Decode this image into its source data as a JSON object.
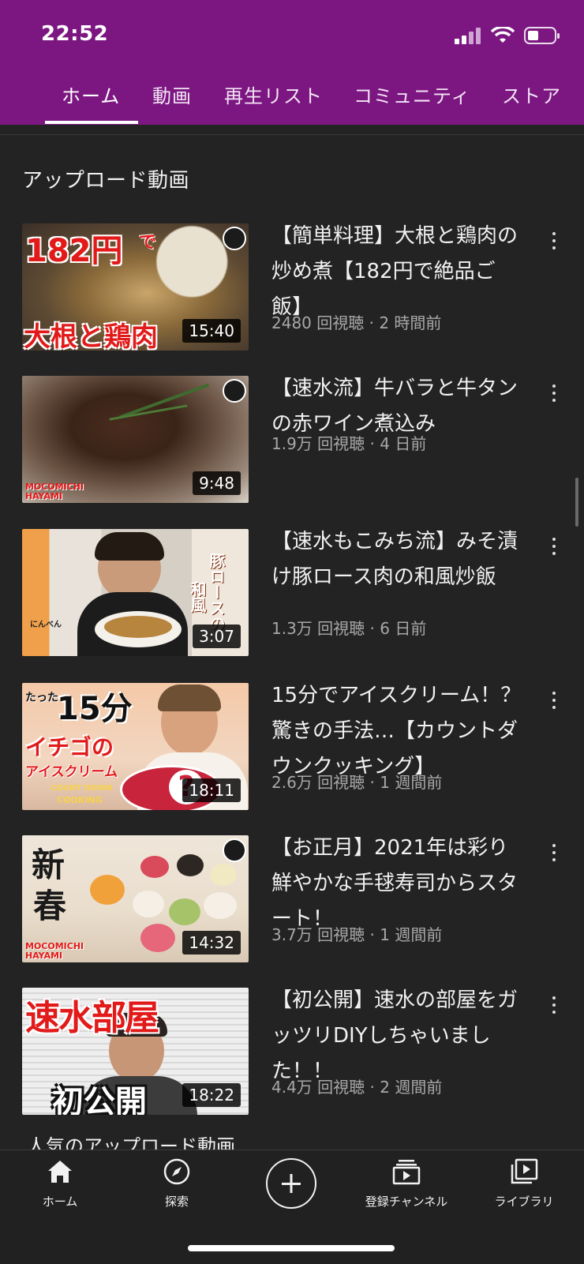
{
  "status": {
    "time": "22:52"
  },
  "tabs": [
    {
      "label": "ホーム",
      "active": true
    },
    {
      "label": "動画"
    },
    {
      "label": "再生リスト"
    },
    {
      "label": "コミュニティ"
    },
    {
      "label": "ストア"
    }
  ],
  "section": {
    "title": "アップロード動画"
  },
  "videos": [
    {
      "title": "【簡単料理】大根と鶏肉の炒め煮【182円で絶品ご飯】",
      "meta": "2480 回視聴 · 2 時間前",
      "duration": "15:40",
      "thumb_text": [
        "182円",
        "で",
        "大根と鶏肉"
      ]
    },
    {
      "title": "【速水流】牛バラと牛タンの赤ワイン煮込み",
      "meta": "1.9万 回視聴 · 4 日前",
      "duration": "9:48",
      "thumb_text": [
        "MOCOMICHI",
        "HAYAMI"
      ]
    },
    {
      "title": "【速水もこみち流】みそ漬け豚ロース肉の和風炒飯",
      "meta": "1.3万 回視聴 · 6 日前",
      "duration": "3:07",
      "thumb_text": [
        "豚ロースの",
        "和風",
        "にんべん"
      ]
    },
    {
      "title": "15分でアイスクリーム！？驚きの手法…【カウントダウンクッキング】",
      "meta": "2.6万 回視聴 · 1 週間前",
      "duration": "18:11",
      "thumb_text": [
        "たった",
        "15分",
        "イチゴの",
        "アイスクリーム",
        "COUNT DOWN",
        "COOKING"
      ]
    },
    {
      "title": "【お正月】2021年は彩り鮮やかな手毬寿司からスタート！",
      "meta": "3.7万 回視聴 · 1 週間前",
      "duration": "14:32",
      "thumb_text": [
        "新",
        "春",
        "MOCOMICHI",
        "HAYAMI"
      ]
    },
    {
      "title": "【初公開】速水の部屋をガッツリDIYしちゃいました！！",
      "meta": "4.4万 回視聴 · 2 週間前",
      "duration": "18:22",
      "thumb_text": [
        "速水部屋",
        "初公開"
      ]
    }
  ],
  "next_section": {
    "title": "人気のアップロード動画"
  },
  "bottom_nav": [
    {
      "label": "ホーム",
      "icon": "home-icon"
    },
    {
      "label": "探索",
      "icon": "compass-icon"
    },
    {
      "label": "",
      "icon": "plus-icon"
    },
    {
      "label": "登録チャンネル",
      "icon": "subscriptions-icon"
    },
    {
      "label": "ライブラリ",
      "icon": "library-icon"
    }
  ],
  "colors": {
    "header": "#7c1782",
    "background": "#232323"
  }
}
